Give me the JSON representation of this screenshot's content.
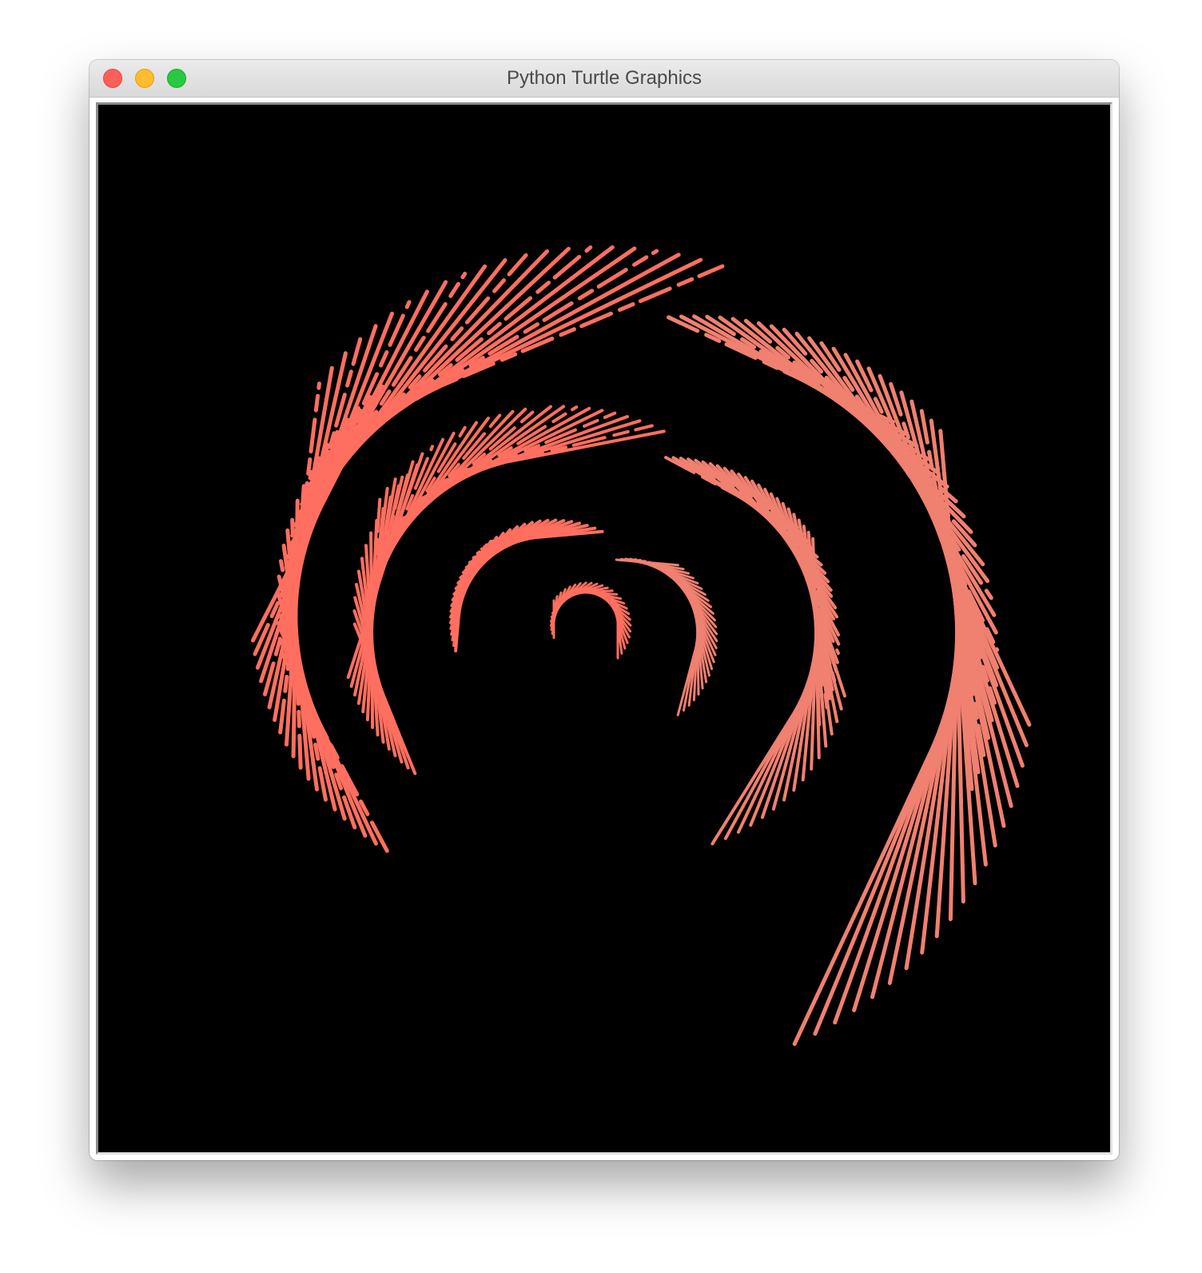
{
  "window": {
    "title": "Python Turtle Graphics"
  },
  "controls": {
    "close": "close-button",
    "minimize": "minimize-button",
    "zoom": "zoom-button"
  },
  "canvas": {
    "background": "#000000",
    "stroke_color": "#ff6f5f",
    "stroke_color_light": "#f08070"
  }
}
